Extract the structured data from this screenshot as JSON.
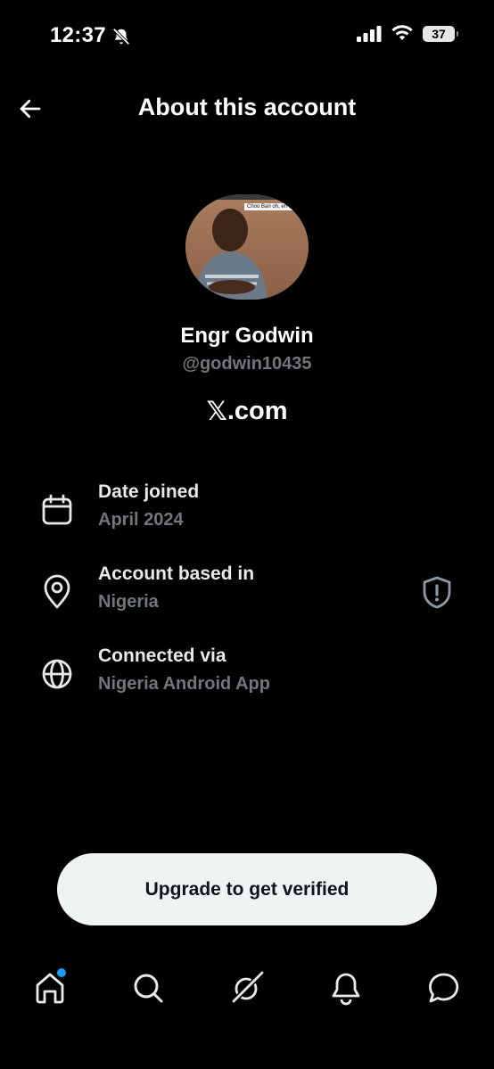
{
  "status_bar": {
    "time": "12:37",
    "battery_level": "37",
    "icons": [
      "bell-slash-icon",
      "cellular-signal-icon",
      "wifi-icon",
      "battery-icon"
    ]
  },
  "header": {
    "title": "About this account",
    "back_icon": "arrow-left-icon"
  },
  "profile": {
    "display_name": "Engr Godwin",
    "username": "@godwin10435",
    "avatar_caption": "Choo Bari oh, eh na sira",
    "site_logo": "𝕏",
    "site_suffix": ".com"
  },
  "details": [
    {
      "icon": "calendar-icon",
      "label": "Date joined",
      "value": "April 2024"
    },
    {
      "icon": "location-pin-icon",
      "label": "Account based in",
      "value": "Nigeria"
    },
    {
      "icon": "globe-icon",
      "label": "Connected via",
      "value": "Nigeria Android App"
    }
  ],
  "shield_icon": "shield-alert-icon",
  "upgrade_button": {
    "label": "Upgrade to get verified"
  },
  "bottom_nav": {
    "items": [
      "home-icon",
      "search-icon",
      "grok-icon",
      "notifications-icon",
      "messages-icon"
    ],
    "home_has_new": true
  },
  "colors": {
    "background": "#000000",
    "primary_text": "#e7e9ea",
    "secondary_text": "#71767b",
    "button_bg": "#eff3f4",
    "accent": "#1d9bf0"
  }
}
